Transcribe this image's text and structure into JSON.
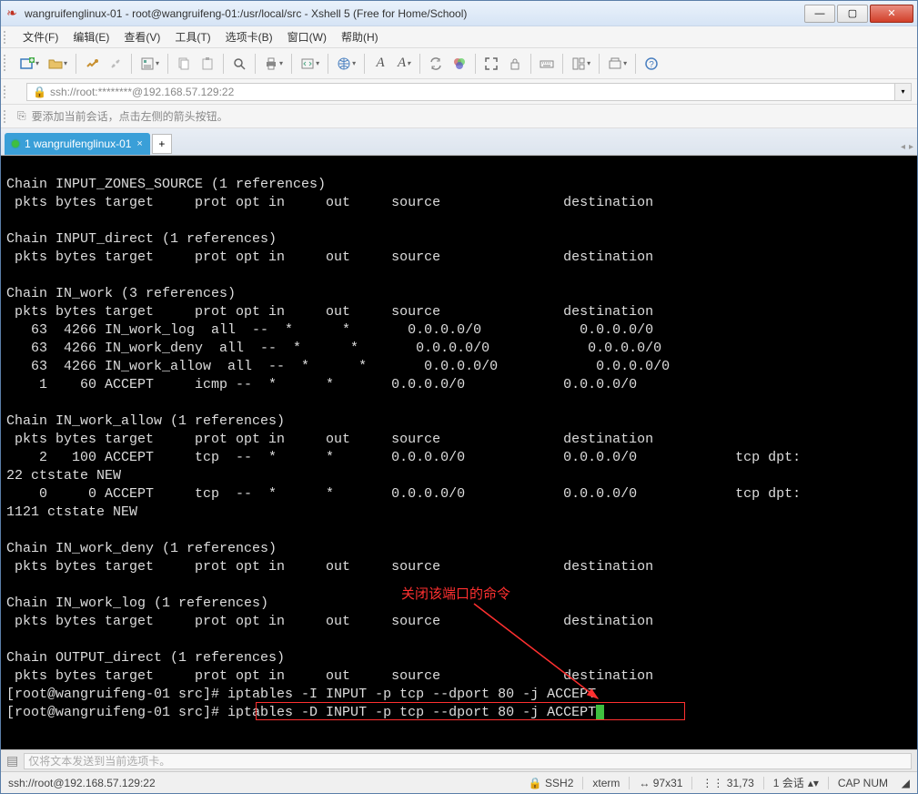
{
  "window": {
    "title": "wangruifenglinux-01 - root@wangruifeng-01:/usr/local/src - Xshell 5 (Free for Home/School)"
  },
  "menus": [
    "文件(F)",
    "编辑(E)",
    "查看(V)",
    "工具(T)",
    "选项卡(B)",
    "窗口(W)",
    "帮助(H)"
  ],
  "address": "ssh://root:********@192.168.57.129:22",
  "hint": "要添加当前会话，点击左侧的箭头按钮。",
  "tab": {
    "label": "1 wangruifenglinux-01"
  },
  "terminal_lines": [
    "",
    "Chain INPUT_ZONES_SOURCE (1 references)",
    " pkts bytes target     prot opt in     out     source               destination",
    "",
    "Chain INPUT_direct (1 references)",
    " pkts bytes target     prot opt in     out     source               destination",
    "",
    "Chain IN_work (3 references)",
    " pkts bytes target     prot opt in     out     source               destination",
    "   63  4266 IN_work_log  all  --  *      *       0.0.0.0/0            0.0.0.0/0",
    "   63  4266 IN_work_deny  all  --  *      *       0.0.0.0/0            0.0.0.0/0",
    "   63  4266 IN_work_allow  all  --  *      *       0.0.0.0/0            0.0.0.0/0",
    "    1    60 ACCEPT     icmp --  *      *       0.0.0.0/0            0.0.0.0/0",
    "",
    "Chain IN_work_allow (1 references)",
    " pkts bytes target     prot opt in     out     source               destination",
    "    2   100 ACCEPT     tcp  --  *      *       0.0.0.0/0            0.0.0.0/0            tcp dpt:",
    "22 ctstate NEW",
    "    0     0 ACCEPT     tcp  --  *      *       0.0.0.0/0            0.0.0.0/0            tcp dpt:",
    "1121 ctstate NEW",
    "",
    "Chain IN_work_deny (1 references)",
    " pkts bytes target     prot opt in     out     source               destination",
    "",
    "Chain IN_work_log (1 references)",
    " pkts bytes target     prot opt in     out     source               destination",
    "",
    "Chain OUTPUT_direct (1 references)",
    " pkts bytes target     prot opt in     out     source               destination",
    "[root@wangruifeng-01 src]# iptables -I INPUT -p tcp --dport 80 -j ACCEPT",
    "[root@wangruifeng-01 src]# iptables -D INPUT -p tcp --dport 80 -j ACCEPT"
  ],
  "annotation_text": "关闭该端口的命令",
  "inputbar_placeholder": "仅将文本发送到当前选项卡。",
  "status": {
    "left": "ssh://root@192.168.57.129:22",
    "ssh": "SSH2",
    "term": "xterm",
    "size": "97x31",
    "pos": "31,73",
    "sessions": "1 会话",
    "caps": "CAP NUM"
  }
}
